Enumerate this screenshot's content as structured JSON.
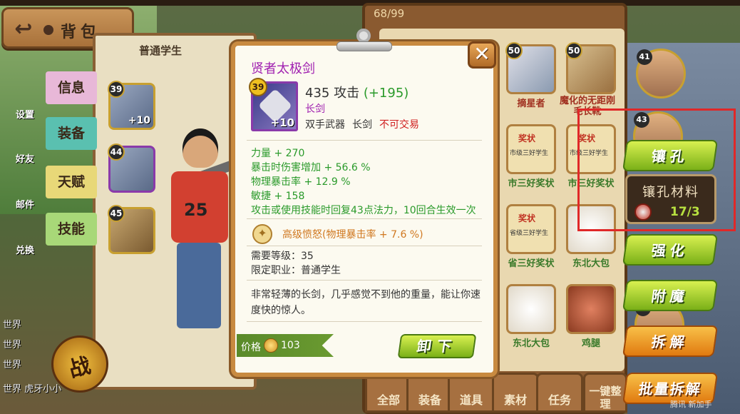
{
  "header": {
    "back_label": "背包"
  },
  "character_panel": {
    "class_title": "普通学生",
    "shirt_number": "25"
  },
  "side_nav": [
    {
      "label": "设置",
      "kind": "icon"
    },
    {
      "label": "好友",
      "kind": "icon"
    },
    {
      "label": "邮件",
      "kind": "icon"
    },
    {
      "label": "兑换",
      "kind": "icon"
    }
  ],
  "side_tabs": [
    "信息",
    "装备",
    "天赋",
    "技能"
  ],
  "equipped_slots": [
    {
      "level": "39",
      "plus": "+10"
    },
    {
      "level": "44",
      "plus": ""
    },
    {
      "level": "45",
      "plus": ""
    }
  ],
  "inventory": {
    "count": "68/99",
    "items": [
      {
        "level": "50",
        "name": "摘星者",
        "color": "red"
      },
      {
        "level": "50",
        "name": "魔化的无距刚毛长靴",
        "color": "red"
      },
      {
        "level": "",
        "name": "市三好奖状",
        "color": "green"
      },
      {
        "level": "",
        "name": "市三好奖状",
        "color": "green"
      },
      {
        "level": "",
        "name": "省三好奖状",
        "color": "green"
      },
      {
        "level": "",
        "name": "东北大包",
        "color": "green"
      },
      {
        "level": "",
        "name": "东北大包",
        "color": "green"
      },
      {
        "level": "",
        "name": "鸡腿",
        "color": "green"
      }
    ],
    "certificate_text": "奖状",
    "certificate_sub_city": "市级三好学生",
    "certificate_sub_prov": "省级三好学生",
    "tabs": [
      "全部",
      "装备",
      "道具",
      "素材",
      "任务",
      "一键整理"
    ]
  },
  "portraits": [
    {
      "level": "41"
    },
    {
      "level": "43"
    },
    {
      "level": "42"
    }
  ],
  "actions": {
    "socket": "镶孔",
    "material_title": "镶孔材料",
    "material_count": "17/3",
    "enhance": "强化",
    "enchant": "附魔",
    "disassemble": "拆解",
    "batch_disassemble": "批量拆解"
  },
  "tooltip": {
    "item_name": "贤者太极剑",
    "icon_level": "39",
    "icon_plus": "+10",
    "attack_text": "435 攻击",
    "attack_bonus": "(+195)",
    "subtype": "长剑",
    "hand": "双手武器",
    "weapon_type": "长剑",
    "trade": "不可交易",
    "stats": [
      "力量 + 270",
      "暴击时伤害增加 + 56.6 %",
      "物理暴击率 + 12.9 %",
      "敏捷 + 158",
      "攻击或使用技能时回复43点法力，10回合生效一次"
    ],
    "gem": "高级愤怒(物理暴击率 + 7.6 %)",
    "req_level": "需要等级：35",
    "req_class": "限定职业：普通学生",
    "description": "非常轻薄的长剑，几乎感觉不到他的重量，能让你速度快的惊人。",
    "price_label": "价格",
    "price_value": "103",
    "unequip_label": "卸下",
    "close_symbol": "✕"
  },
  "chat_lines": [
    "世界",
    "世界",
    "世界",
    "世界 虎牙小小"
  ],
  "battle_label": "战",
  "watermark": "腾讯 新加手",
  "colors": {
    "highlight": "#e02828",
    "stat_green": "#2a9a2a",
    "item_purple": "#a020b0",
    "gem_orange": "#d07820"
  }
}
